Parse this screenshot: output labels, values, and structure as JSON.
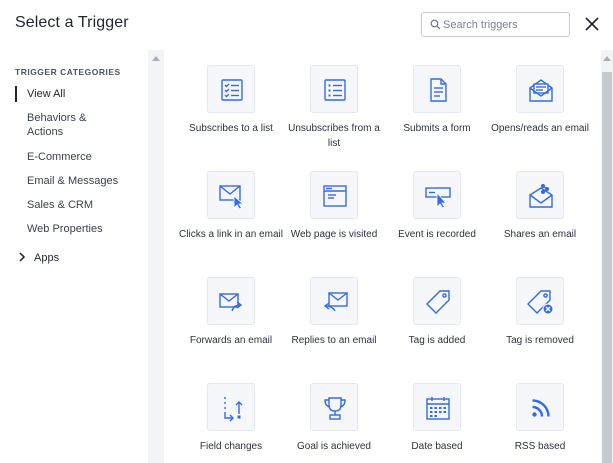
{
  "header": {
    "title": "Select a Trigger",
    "search_placeholder": "Search triggers"
  },
  "sidebar": {
    "heading": "TRIGGER CATEGORIES",
    "items": [
      {
        "label": "View All"
      },
      {
        "label": "Behaviors & Actions"
      },
      {
        "label": "E-Commerce"
      },
      {
        "label": "Email & Messages"
      },
      {
        "label": "Sales & CRM"
      },
      {
        "label": "Web Properties"
      }
    ],
    "apps_label": "Apps"
  },
  "triggers": [
    {
      "label": "Subscribes to a list",
      "icon": "checklist-icon"
    },
    {
      "label": "Unsubscribes from a list",
      "icon": "list-icon"
    },
    {
      "label": "Submits a form",
      "icon": "form-document-icon"
    },
    {
      "label": "Opens/reads an email",
      "icon": "open-envelope-icon"
    },
    {
      "label": "Clicks a link in an email",
      "icon": "envelope-cursor-icon"
    },
    {
      "label": "Web page is visited",
      "icon": "browser-window-icon"
    },
    {
      "label": "Event is recorded",
      "icon": "event-cursor-icon"
    },
    {
      "label": "Shares an email",
      "icon": "share-envelope-icon"
    },
    {
      "label": "Forwards an email",
      "icon": "forward-envelope-icon"
    },
    {
      "label": "Replies to an email",
      "icon": "reply-envelope-icon"
    },
    {
      "label": "Tag is added",
      "icon": "tag-icon"
    },
    {
      "label": "Tag is removed",
      "icon": "tag-remove-icon"
    },
    {
      "label": "Field changes",
      "icon": "field-change-icon"
    },
    {
      "label": "Goal is achieved",
      "icon": "trophy-icon"
    },
    {
      "label": "Date based",
      "icon": "calendar-icon"
    },
    {
      "label": "RSS based",
      "icon": "rss-icon"
    }
  ],
  "colors": {
    "accent": "#356ae6",
    "tile_bg": "#f5f7fb",
    "tile_border": "#e4e7ec"
  }
}
